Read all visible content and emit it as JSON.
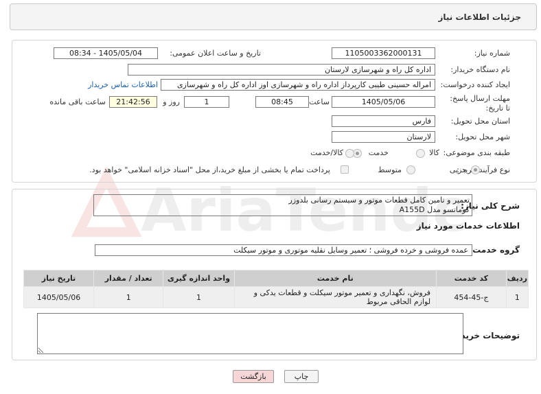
{
  "header": {
    "title": "جزئیات اطلاعات نیاز"
  },
  "watermark": {
    "text": "AriaTender.net"
  },
  "form": {
    "need_number": {
      "label": "شماره نیاز:",
      "value": "1105003362000131"
    },
    "announce_datetime": {
      "label": "تاریخ و ساعت اعلان عمومی:",
      "value": "1405/05/04 - 08:34"
    },
    "buyer_org": {
      "label": "نام دستگاه خریدار:",
      "value": "اداره کل راه و شهرسازی لارستان"
    },
    "requester": {
      "label": "ایجاد کننده درخواست:",
      "value": "امراله حسینی طیبی کارپرداز اداره راه و شهرسازی اوز اداره کل راه و شهرسازی",
      "contact_link": "اطلاعات تماس خریدار"
    },
    "deadline": {
      "label": "مهلت ارسال پاسخ: تا تاریخ:",
      "date": "1405/05/06",
      "time_label": "ساعت",
      "time": "08:45",
      "days": "1",
      "days_label": "روز و",
      "remaining": "21:42:56",
      "remaining_label": "ساعت باقی مانده"
    },
    "province": {
      "label": "استان محل تحویل:",
      "value": "فارس"
    },
    "city": {
      "label": "شهر محل تحویل:",
      "value": "لارستان"
    },
    "category": {
      "label": "طبقه بندی موضوعی:",
      "options": [
        "کالا",
        "خدمت",
        "کالا/خدمت"
      ],
      "selected": "خدمت"
    },
    "purchase_type": {
      "label": "نوع فرآیند خرید :",
      "options": [
        "جزیی",
        "متوسط"
      ],
      "selected": "جزیی",
      "note": "پرداخت تمام یا بخشی از مبلغ خرید،از محل \"اسناد خزانه اسلامی\" خواهد بود."
    }
  },
  "summary": {
    "label": "شرح کلی نیاز:",
    "line1": "تعمیر و تامین کامل قطعات موتور و سیستم رسانی بلدوزر",
    "line2": "کوماتسو مدل A155D"
  },
  "services": {
    "section_title": "اطلاعات خدمات مورد نیاز",
    "group_label": "گروه خدمت:",
    "group_value": "عمده فروشی و خرده فروشی ؛ تعمیر وسایل نقلیه موتوری و موتور سیکلت",
    "columns": [
      "ردیف",
      "کد خدمت",
      "نام خدمت",
      "واحد اندازه گیری",
      "تعداد / مقدار",
      "تاریخ نیاز"
    ],
    "rows": [
      {
        "row": "1",
        "code": "ج-45-454",
        "name": "فروش، نگهداری و تعمیر موتور سیکلت و قطعات یدکی و لوازم الحاقی مربوط",
        "unit": "1",
        "qty": "1",
        "date": "1405/05/06"
      }
    ]
  },
  "buyer_notes": {
    "label": "توضیحات خریدار:",
    "value": ""
  },
  "buttons": {
    "print": "چاپ",
    "back": "بازگشت"
  },
  "colors": {
    "back_button_bg": "#f6d6d6",
    "print_button_bg": "#f4f4f4",
    "link": "#1a5fb4"
  }
}
